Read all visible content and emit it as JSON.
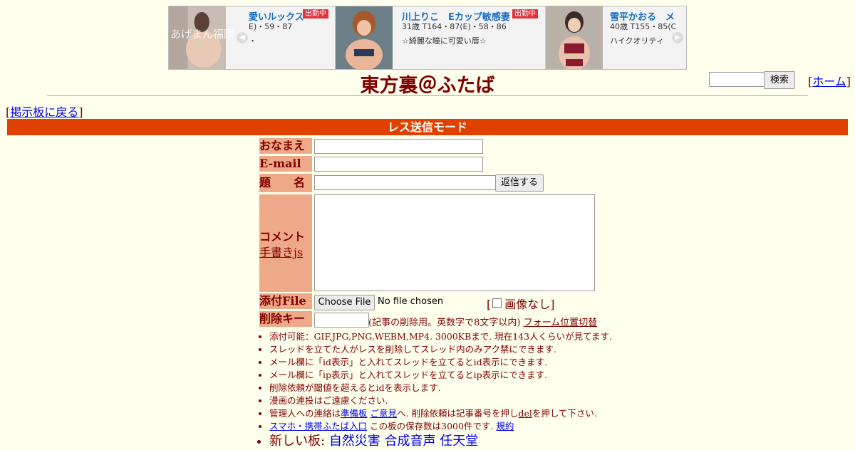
{
  "banner": {
    "cards": [
      {
        "name": "愛いルックス",
        "badge": "出勤中",
        "stat": "E)・59・87",
        "tag": "・"
      },
      {
        "name": "川上りこ　Eカップ敏感妻",
        "badge": "出勤中",
        "stat": "31歳 T164・87(E)・58・86",
        "tag": "☆綺麗な瞳に可愛い唇☆"
      },
      {
        "name": "雪平かおる　メ",
        "badge": "",
        "stat": "40歳 T155・85(C",
        "tag": "ハイクオリティ"
      }
    ],
    "logo_text": "あげまん福岡",
    "prev_icon": "chevron-left-icon",
    "next_icon": "chevron-right-icon"
  },
  "header": {
    "title": "東方裏＠ふたば",
    "search_button": "検索",
    "home_link": "ホーム"
  },
  "nav": {
    "back_link": "掲示板に戻る"
  },
  "mode_bar": "レス送信モード",
  "form": {
    "name_label": "おなまえ",
    "email_label": "E-mail",
    "subject_label": "題　　名",
    "submit_button": "返信する",
    "comment_label": "コメント",
    "handwrite_link": "手書きjs",
    "file_label": "添付File",
    "choose_file_button": "Choose File",
    "no_file_text": "No file chosen",
    "no_image_label": "画像なし",
    "delkey_label": "削除キー",
    "delkey_note": "(記事の削除用。英数字で8文字以内)",
    "form_toggle_link": "フォーム位置切替"
  },
  "rules": [
    {
      "text": "添付可能：GIF,JPG,PNG,WEBM,MP4. 3000KBまで. 現在143人くらいが見てます."
    },
    {
      "text": "スレッドを立てた人がレスを削除してスレッド内のみアク禁にできます."
    },
    {
      "text": "メール欄に「id表示」と入れてスレッドを立てるとid表示にできます."
    },
    {
      "text": "メール欄に「ip表示」と入れてスレッドを立てるとip表示にできます."
    },
    {
      "text": "削除依頼が閾値を超えるとidを表示します."
    },
    {
      "text": "漫画の連投はご遠慮ください."
    }
  ],
  "contact": {
    "prefix": "管理人への連絡は",
    "link1": "準備板",
    "link2": "ご意見",
    "mid": "へ. 削除依頼は記事番号を押し",
    "del_link": "del",
    "suffix": "を押して下さい."
  },
  "mobile": {
    "link": "スマホ・携帯ふたば入口",
    "text": "この板の保存数は3000件です.",
    "rules_link": "規約"
  },
  "new_boards": {
    "label": "新しい板:",
    "links": [
      "自然災害",
      "合成音声",
      "任天堂"
    ]
  }
}
